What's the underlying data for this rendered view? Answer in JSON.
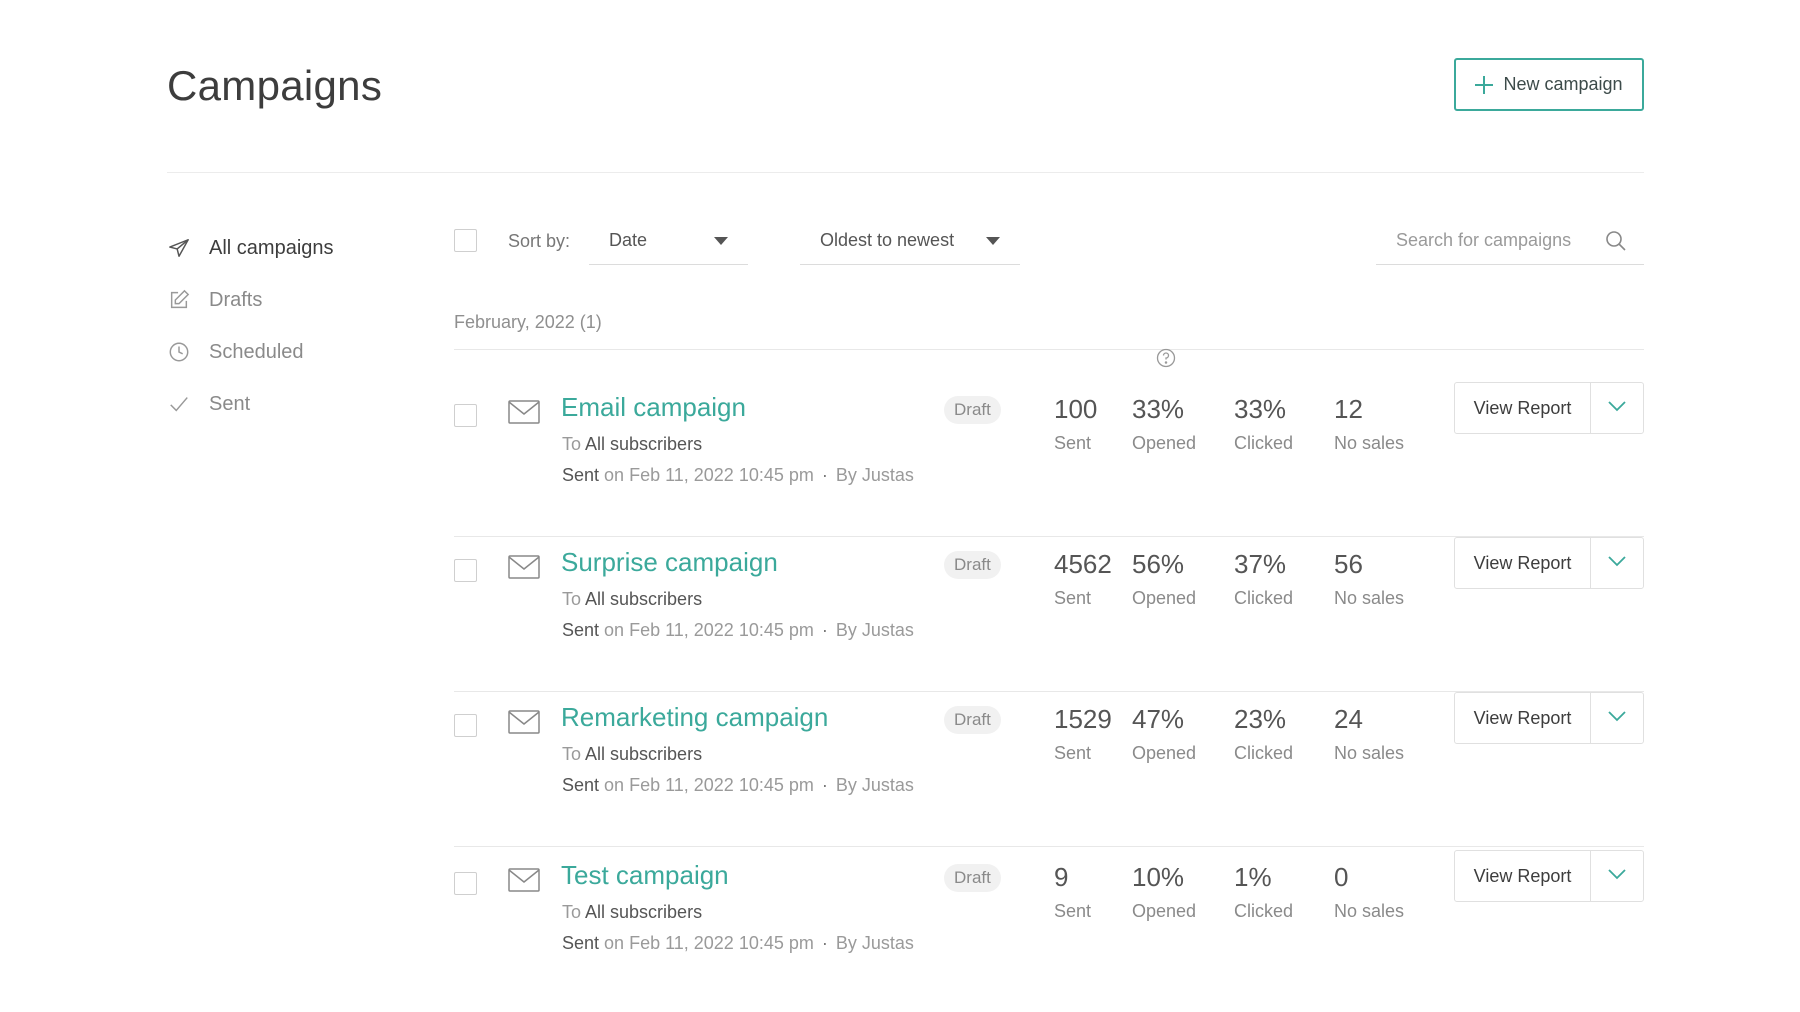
{
  "header": {
    "title": "Campaigns",
    "new_campaign_label": "New campaign"
  },
  "sidebar": {
    "items": [
      {
        "label": "All campaigns",
        "icon": "paper-plane-icon",
        "active": true
      },
      {
        "label": "Drafts",
        "icon": "edit-icon",
        "active": false
      },
      {
        "label": "Scheduled",
        "icon": "clock-icon",
        "active": false
      },
      {
        "label": "Sent",
        "icon": "check-icon",
        "active": false
      }
    ]
  },
  "toolbar": {
    "sort_label": "Sort by:",
    "sort_field": "Date",
    "sort_order": "Oldest to newest",
    "search_placeholder": "Search for campaigns"
  },
  "group": {
    "label": "February, 2022 (1)"
  },
  "colors": {
    "accent": "#3ba99b"
  },
  "campaigns": [
    {
      "name": "Email campaign",
      "to_prefix": "To",
      "recipients": "All subscribers",
      "status": "Sent",
      "date": "on Feb 11, 2022 10:45 pm",
      "dot": "·",
      "author": "By Justas",
      "badge": "Draft",
      "sent": "100",
      "sent_label": "Sent",
      "opened": "33%",
      "opened_label": "Opened",
      "clicked": "33%",
      "clicked_label": "Clicked",
      "sales": "12",
      "sales_label": "No sales",
      "action": "View Report"
    },
    {
      "name": "Surprise campaign",
      "to_prefix": "To",
      "recipients": "All subscribers",
      "status": "Sent",
      "date": "on Feb 11, 2022 10:45 pm",
      "dot": "·",
      "author": "By Justas",
      "badge": "Draft",
      "sent": "4562",
      "sent_label": "Sent",
      "opened": "56%",
      "opened_label": "Opened",
      "clicked": "37%",
      "clicked_label": "Clicked",
      "sales": "56",
      "sales_label": "No sales",
      "action": "View Report"
    },
    {
      "name": "Remarketing campaign",
      "to_prefix": "To",
      "recipients": "All subscribers",
      "status": "Sent",
      "date": "on Feb 11, 2022 10:45 pm",
      "dot": "·",
      "author": "By Justas",
      "badge": "Draft",
      "sent": "1529",
      "sent_label": "Sent",
      "opened": "47%",
      "opened_label": "Opened",
      "clicked": "23%",
      "clicked_label": "Clicked",
      "sales": "24",
      "sales_label": "No sales",
      "action": "View Report"
    },
    {
      "name": "Test campaign",
      "to_prefix": "To",
      "recipients": "All subscribers",
      "status": "Sent",
      "date": "on Feb 11, 2022 10:45 pm",
      "dot": "·",
      "author": "By Justas",
      "badge": "Draft",
      "sent": "9",
      "sent_label": "Sent",
      "opened": "10%",
      "opened_label": "Opened",
      "clicked": "1%",
      "clicked_label": "Clicked",
      "sales": "0",
      "sales_label": "No sales",
      "action": "View Report"
    }
  ]
}
